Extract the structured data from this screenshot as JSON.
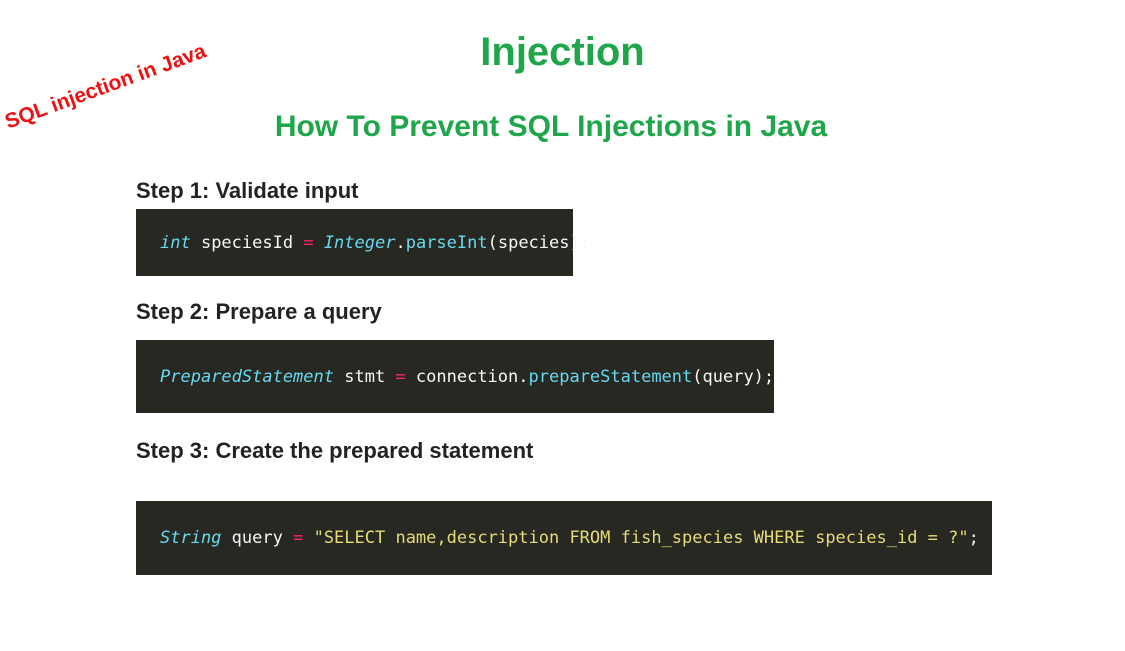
{
  "title": "Injection",
  "subtitle": "How To Prevent SQL Injections in Java",
  "stamp": "SQL injection in Java",
  "steps": [
    {
      "label": "Step 1: Validate input",
      "code": {
        "type": "int",
        "var": " speciesId ",
        "op": "=",
        "sp": " ",
        "cls": "Integer",
        "dot": ".",
        "method": "parseInt",
        "args": "(species);"
      }
    },
    {
      "label": "Step 2: Prepare a query",
      "code": {
        "type": "PreparedStatement",
        "var": " stmt ",
        "op": "=",
        "obj": " connection.",
        "method": "prepareStatement",
        "args": "(query);"
      }
    },
    {
      "label": "Step 3: Create the prepared statement",
      "code": {
        "type": "String",
        "var": " query ",
        "op": "=",
        "sp": " ",
        "str": "\"SELECT name,description FROM fish_species WHERE species_id = ?\"",
        "end": ";"
      }
    }
  ]
}
